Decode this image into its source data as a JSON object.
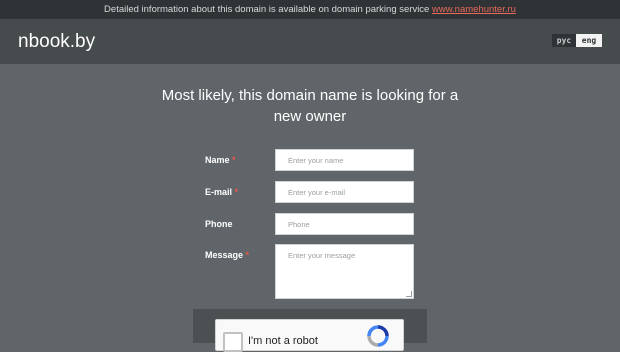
{
  "topbar": {
    "text": "Detailed information about this domain is available on domain parking service",
    "link": "www.namehunter.ru"
  },
  "header": {
    "logo": "nbook.by",
    "lang_rus": "рус",
    "lang_eng": "eng"
  },
  "headline": {
    "line1": "Most likely, this domain name is looking for a",
    "line2": "new owner"
  },
  "form": {
    "required_mark": "*",
    "name_label": "Name",
    "name_placeholder": "Enter your name",
    "email_label": "E-mail",
    "email_placeholder": "Enter your e-mail",
    "phone_label": "Phone",
    "phone_placeholder": "Phone",
    "message_label": "Message",
    "message_placeholder": "Enter your message"
  },
  "captcha": {
    "label": "I'm not a robot"
  },
  "colors": {
    "page_background": "#5f6568",
    "header_background": "#464b4e",
    "topbar_background": "#2f3335",
    "link": "#e86a5a",
    "required": "#e8584a"
  }
}
